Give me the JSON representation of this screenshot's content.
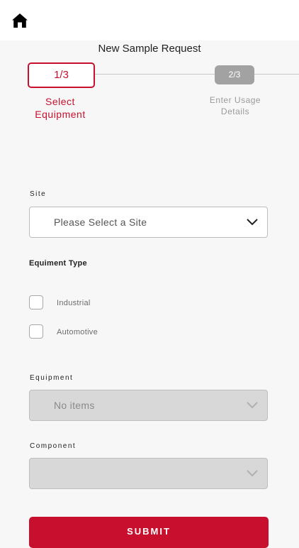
{
  "header": {
    "home_icon": "home-icon"
  },
  "title": "New Sample Request",
  "steps": [
    {
      "number": "1/3",
      "label_line1": "Select",
      "label_line2": "Equipment",
      "state": "active"
    },
    {
      "number": "2/3",
      "label_line1": "Enter Usage",
      "label_line2": "Details",
      "state": "inactive"
    }
  ],
  "form": {
    "site": {
      "label": "Site",
      "placeholder": "Please Select a Site"
    },
    "equipment_type": {
      "label": "Equiment Type",
      "options": [
        {
          "label": "Industrial",
          "checked": false
        },
        {
          "label": "Automotive",
          "checked": false
        }
      ]
    },
    "equipment": {
      "label": "Equipment",
      "value": "No items",
      "disabled": true
    },
    "component": {
      "label": "Component",
      "value": "",
      "disabled": true
    }
  },
  "submit_label": "SUBMIT",
  "colors": {
    "accent": "#c8102e",
    "step_inactive": "#a2a2a2",
    "disabled_field": "#d8d8d8"
  }
}
